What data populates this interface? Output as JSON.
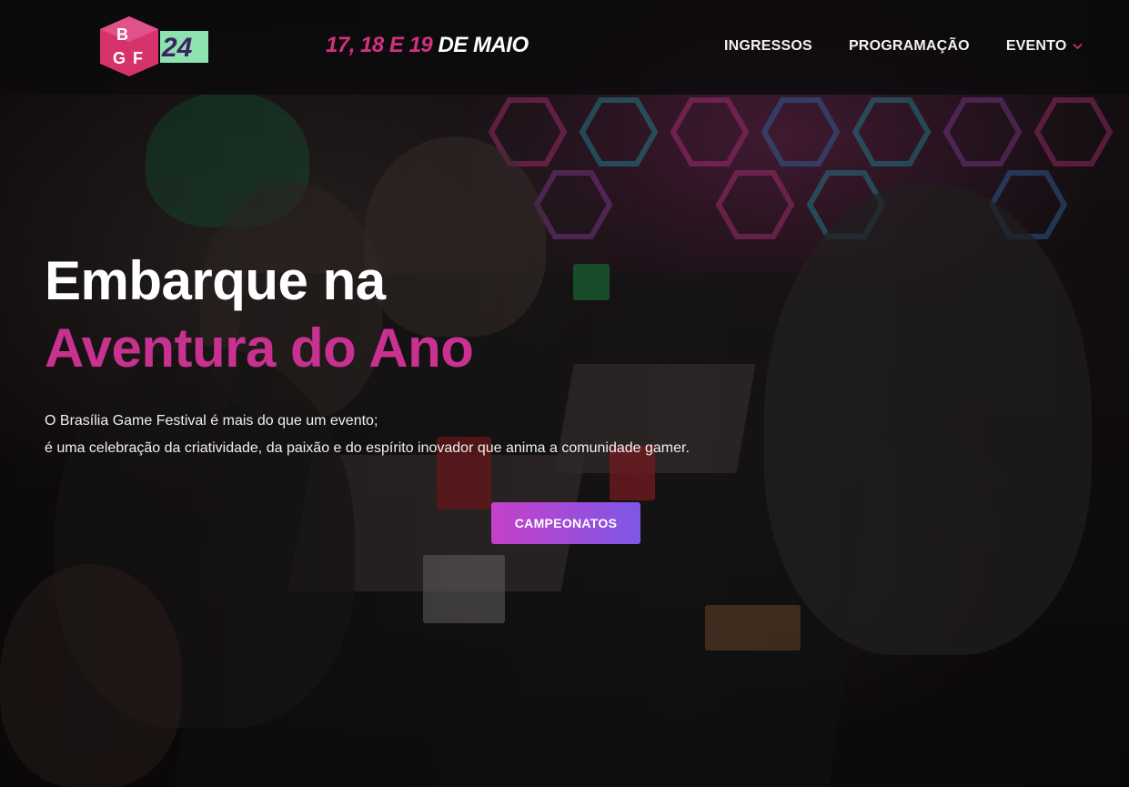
{
  "header": {
    "logo": {
      "letters": [
        "B",
        "G",
        "F"
      ],
      "year": "24"
    },
    "date": {
      "days": "17, 18 E 19",
      "month": "DE MAIO"
    },
    "nav": [
      {
        "label": "INGRESSOS"
      },
      {
        "label": "PROGRAMAÇÃO"
      },
      {
        "label": "EVENTO",
        "has_dropdown": true
      }
    ]
  },
  "hero": {
    "title_line1": "Embarque na",
    "title_line2": "Aventura do Ano",
    "description_line1": "O Brasília Game Festival é mais do que um evento;",
    "description_line2": "é uma celebração da criatividade, da paixão e do espírito inovador que anima a comunidade gamer.",
    "cta_label": "CAMPEONATOS"
  },
  "colors": {
    "accent_pink": "#c8318f",
    "logo_magenta": "#d6336c",
    "logo_green": "#8de3b0",
    "cta_start": "#c640c9",
    "cta_end": "#7e57e6"
  },
  "icons": {
    "background": "gaming-tournament-photo",
    "dropdown": "chevron-down-icon"
  }
}
